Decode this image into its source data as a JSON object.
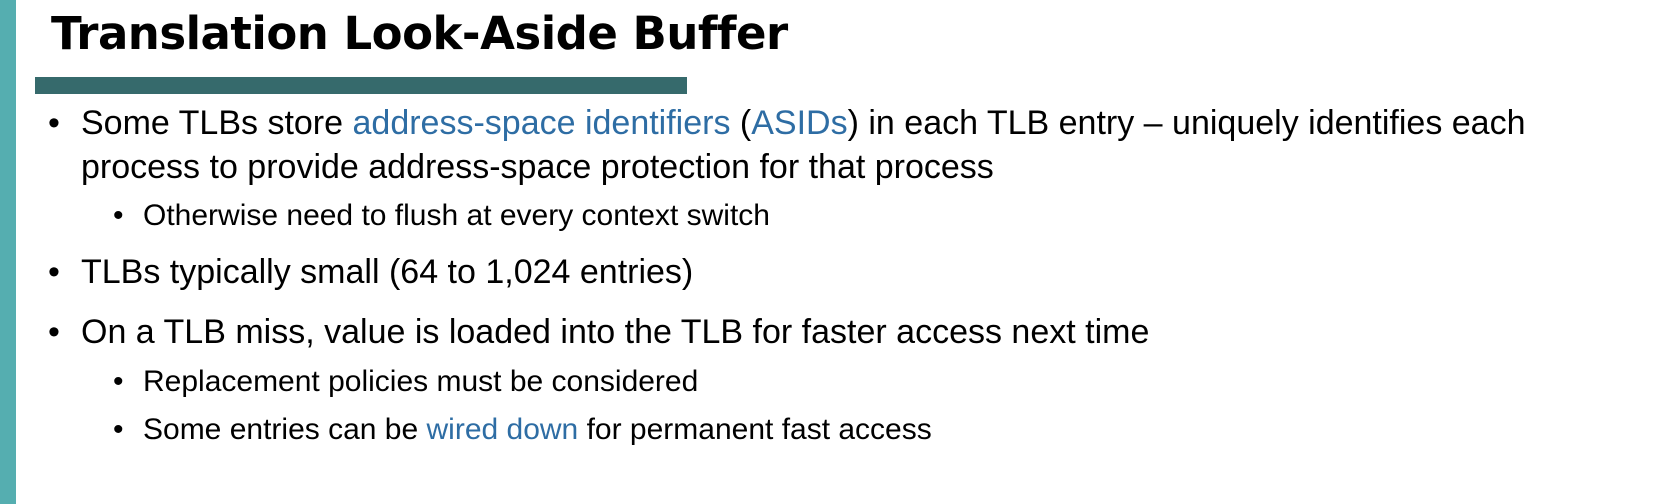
{
  "slide": {
    "title": "Translation Look-Aside Buffer",
    "bullet_symbol": "•",
    "bullets": [
      {
        "line1_pre": "Some TLBs store ",
        "line1_hl1": "address-space identifiers",
        "line1_mid1": " (",
        "line1_hl2": "ASIDs",
        "line1_post": ") in each TLB entry – uniquely identifies each",
        "line2": "process to provide address-space protection for that process",
        "sub": [
          {
            "text": "Otherwise need to flush at every context switch"
          }
        ]
      },
      {
        "text": "TLBs typically small (64 to 1,024 entries)"
      },
      {
        "text": "On a TLB miss, value is loaded into the TLB for faster access next time",
        "sub": [
          {
            "text": "Replacement policies must be considered"
          },
          {
            "pre": "Some entries can be ",
            "hl": "wired down",
            "post": " for permanent fast access"
          }
        ]
      }
    ],
    "colors": {
      "left_bar": "#55aeb0",
      "title_rule": "#366a6c",
      "highlight": "#2e6da4",
      "text": "#000000"
    }
  }
}
